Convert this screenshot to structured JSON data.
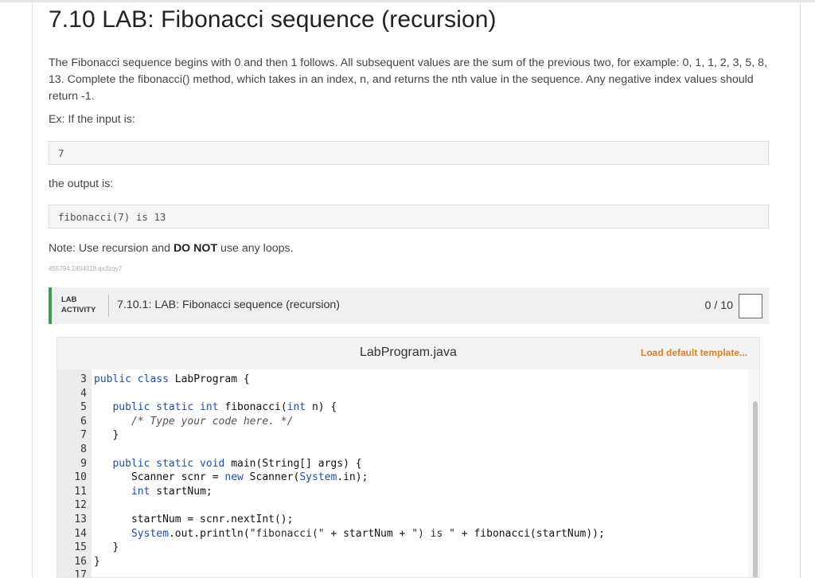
{
  "title": "7.10 LAB: Fibonacci sequence (recursion)",
  "description": "The Fibonacci sequence begins with 0 and then 1 follows. All subsequent values are the sum of the previous two, for example: 0, 1, 1, 2, 3, 5, 8, 13. Complete the fibonacci() method, which takes in an index, n, and returns the nth value in the sequence. Any negative index values should return -1.",
  "example_label": "Ex: If the input is:",
  "example_input": "7",
  "output_label": "the output is:",
  "example_output": "fibonacci(7) is 13",
  "note": {
    "prefix": "Note: Use recursion and ",
    "bold": "DO NOT",
    "suffix": " use any loops."
  },
  "tiny_id": "455794.2454318.qx3zqy7",
  "lab": {
    "tag_line1": "LAB",
    "tag_line2": "ACTIVITY",
    "name": "7.10.1: LAB: Fibonacci sequence (recursion)",
    "score": "0 / 10"
  },
  "editor": {
    "file_name": "LabProgram.java",
    "load_default": "Load default template...",
    "lines": [
      {
        "n": "3",
        "segs": [
          [
            "kw",
            "public class"
          ],
          [
            "",
            "LabProgram {"
          ]
        ]
      },
      {
        "n": "4",
        "segs": []
      },
      {
        "n": "5",
        "segs": [
          [
            "",
            "   "
          ],
          [
            "kw",
            "public static int"
          ],
          [
            "",
            " fibonacci("
          ],
          [
            "kw",
            "int"
          ],
          [
            "",
            " n) {"
          ]
        ]
      },
      {
        "n": "6",
        "segs": [
          [
            "",
            "      "
          ],
          [
            "cmt",
            "/* Type your code here. */"
          ]
        ]
      },
      {
        "n": "7",
        "segs": [
          [
            "",
            "   }"
          ]
        ]
      },
      {
        "n": "8",
        "segs": []
      },
      {
        "n": "9",
        "segs": [
          [
            "",
            "   "
          ],
          [
            "kw",
            "public static void"
          ],
          [
            "",
            " main(String[] args) {"
          ]
        ]
      },
      {
        "n": "10",
        "segs": [
          [
            "",
            "      Scanner scnr = "
          ],
          [
            "kw",
            "new"
          ],
          [
            "",
            " Scanner("
          ],
          [
            "kw",
            "System"
          ],
          [
            "",
            ".in);"
          ]
        ]
      },
      {
        "n": "11",
        "segs": [
          [
            "",
            "      "
          ],
          [
            "kw",
            "int"
          ],
          [
            "",
            " startNum;"
          ]
        ]
      },
      {
        "n": "12",
        "segs": []
      },
      {
        "n": "13",
        "segs": [
          [
            "",
            "      startNum = scnr.nextInt();"
          ]
        ]
      },
      {
        "n": "14",
        "segs": [
          [
            "",
            "      "
          ],
          [
            "kw",
            "System"
          ],
          [
            "",
            ".out.println("
          ],
          [
            "str",
            "\"fibonacci(\""
          ],
          [
            "",
            " + startNum + "
          ],
          [
            "str",
            "\") is \""
          ],
          [
            "",
            " + fibonacci(startNum));"
          ]
        ]
      },
      {
        "n": "15",
        "segs": [
          [
            "",
            "   }"
          ]
        ]
      },
      {
        "n": "16",
        "segs": [
          [
            "",
            "}"
          ]
        ]
      },
      {
        "n": "17",
        "segs": []
      }
    ]
  }
}
